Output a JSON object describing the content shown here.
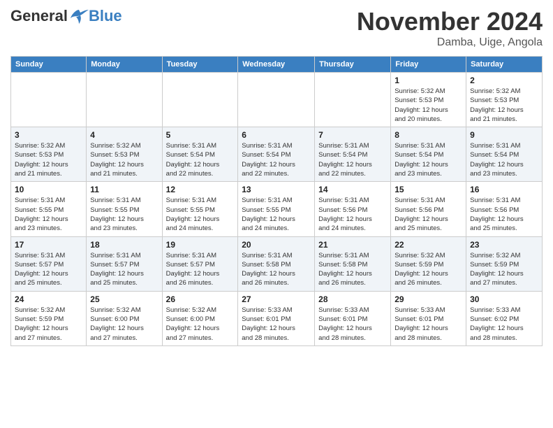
{
  "header": {
    "logo": {
      "general": "General",
      "blue": "Blue"
    },
    "title": "November 2024",
    "location": "Damba, Uige, Angola"
  },
  "days_of_week": [
    "Sunday",
    "Monday",
    "Tuesday",
    "Wednesday",
    "Thursday",
    "Friday",
    "Saturday"
  ],
  "weeks": [
    [
      {
        "day": "",
        "info": ""
      },
      {
        "day": "",
        "info": ""
      },
      {
        "day": "",
        "info": ""
      },
      {
        "day": "",
        "info": ""
      },
      {
        "day": "",
        "info": ""
      },
      {
        "day": "1",
        "info": "Sunrise: 5:32 AM\nSunset: 5:53 PM\nDaylight: 12 hours\nand 20 minutes."
      },
      {
        "day": "2",
        "info": "Sunrise: 5:32 AM\nSunset: 5:53 PM\nDaylight: 12 hours\nand 21 minutes."
      }
    ],
    [
      {
        "day": "3",
        "info": "Sunrise: 5:32 AM\nSunset: 5:53 PM\nDaylight: 12 hours\nand 21 minutes."
      },
      {
        "day": "4",
        "info": "Sunrise: 5:32 AM\nSunset: 5:53 PM\nDaylight: 12 hours\nand 21 minutes."
      },
      {
        "day": "5",
        "info": "Sunrise: 5:31 AM\nSunset: 5:54 PM\nDaylight: 12 hours\nand 22 minutes."
      },
      {
        "day": "6",
        "info": "Sunrise: 5:31 AM\nSunset: 5:54 PM\nDaylight: 12 hours\nand 22 minutes."
      },
      {
        "day": "7",
        "info": "Sunrise: 5:31 AM\nSunset: 5:54 PM\nDaylight: 12 hours\nand 22 minutes."
      },
      {
        "day": "8",
        "info": "Sunrise: 5:31 AM\nSunset: 5:54 PM\nDaylight: 12 hours\nand 23 minutes."
      },
      {
        "day": "9",
        "info": "Sunrise: 5:31 AM\nSunset: 5:54 PM\nDaylight: 12 hours\nand 23 minutes."
      }
    ],
    [
      {
        "day": "10",
        "info": "Sunrise: 5:31 AM\nSunset: 5:55 PM\nDaylight: 12 hours\nand 23 minutes."
      },
      {
        "day": "11",
        "info": "Sunrise: 5:31 AM\nSunset: 5:55 PM\nDaylight: 12 hours\nand 23 minutes."
      },
      {
        "day": "12",
        "info": "Sunrise: 5:31 AM\nSunset: 5:55 PM\nDaylight: 12 hours\nand 24 minutes."
      },
      {
        "day": "13",
        "info": "Sunrise: 5:31 AM\nSunset: 5:55 PM\nDaylight: 12 hours\nand 24 minutes."
      },
      {
        "day": "14",
        "info": "Sunrise: 5:31 AM\nSunset: 5:56 PM\nDaylight: 12 hours\nand 24 minutes."
      },
      {
        "day": "15",
        "info": "Sunrise: 5:31 AM\nSunset: 5:56 PM\nDaylight: 12 hours\nand 25 minutes."
      },
      {
        "day": "16",
        "info": "Sunrise: 5:31 AM\nSunset: 5:56 PM\nDaylight: 12 hours\nand 25 minutes."
      }
    ],
    [
      {
        "day": "17",
        "info": "Sunrise: 5:31 AM\nSunset: 5:57 PM\nDaylight: 12 hours\nand 25 minutes."
      },
      {
        "day": "18",
        "info": "Sunrise: 5:31 AM\nSunset: 5:57 PM\nDaylight: 12 hours\nand 25 minutes."
      },
      {
        "day": "19",
        "info": "Sunrise: 5:31 AM\nSunset: 5:57 PM\nDaylight: 12 hours\nand 26 minutes."
      },
      {
        "day": "20",
        "info": "Sunrise: 5:31 AM\nSunset: 5:58 PM\nDaylight: 12 hours\nand 26 minutes."
      },
      {
        "day": "21",
        "info": "Sunrise: 5:31 AM\nSunset: 5:58 PM\nDaylight: 12 hours\nand 26 minutes."
      },
      {
        "day": "22",
        "info": "Sunrise: 5:32 AM\nSunset: 5:59 PM\nDaylight: 12 hours\nand 26 minutes."
      },
      {
        "day": "23",
        "info": "Sunrise: 5:32 AM\nSunset: 5:59 PM\nDaylight: 12 hours\nand 27 minutes."
      }
    ],
    [
      {
        "day": "24",
        "info": "Sunrise: 5:32 AM\nSunset: 5:59 PM\nDaylight: 12 hours\nand 27 minutes."
      },
      {
        "day": "25",
        "info": "Sunrise: 5:32 AM\nSunset: 6:00 PM\nDaylight: 12 hours\nand 27 minutes."
      },
      {
        "day": "26",
        "info": "Sunrise: 5:32 AM\nSunset: 6:00 PM\nDaylight: 12 hours\nand 27 minutes."
      },
      {
        "day": "27",
        "info": "Sunrise: 5:33 AM\nSunset: 6:01 PM\nDaylight: 12 hours\nand 28 minutes."
      },
      {
        "day": "28",
        "info": "Sunrise: 5:33 AM\nSunset: 6:01 PM\nDaylight: 12 hours\nand 28 minutes."
      },
      {
        "day": "29",
        "info": "Sunrise: 5:33 AM\nSunset: 6:01 PM\nDaylight: 12 hours\nand 28 minutes."
      },
      {
        "day": "30",
        "info": "Sunrise: 5:33 AM\nSunset: 6:02 PM\nDaylight: 12 hours\nand 28 minutes."
      }
    ]
  ]
}
